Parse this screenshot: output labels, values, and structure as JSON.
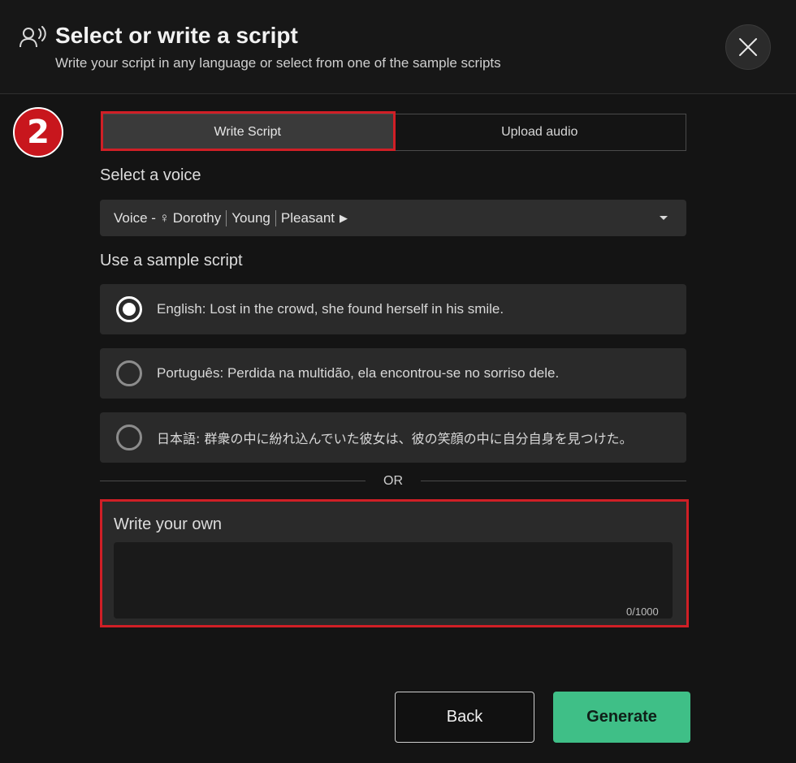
{
  "header": {
    "title": "Select or write a script",
    "subtitle": "Write your script in any language or select from one of the sample scripts",
    "icon": "voice-speaker-icon",
    "close_icon": "close-icon"
  },
  "step_badge": "2",
  "tabs": [
    {
      "label": "Write Script",
      "active": true
    },
    {
      "label": "Upload audio",
      "active": false
    }
  ],
  "voice": {
    "section_label": "Select a voice",
    "prefix": "Voice - ",
    "gender_symbol": "♀",
    "name": "Dorothy",
    "age": "Young",
    "tone": "Pleasant",
    "play_symbol": "▶"
  },
  "samples": {
    "section_label": "Use a sample script",
    "options": [
      {
        "text": "English: Lost in the crowd, she found herself in his smile.",
        "selected": true
      },
      {
        "text": "Português: Perdida na multidão, ela encontrou-se no sorriso dele.",
        "selected": false
      },
      {
        "text": "日本語: 群衆の中に紛れ込んでいた彼女は、彼の笑顔の中に自分自身を見つけた。",
        "selected": false
      }
    ]
  },
  "divider": "OR",
  "own_script": {
    "label": "Write your own",
    "value": "",
    "counter": "0/1000"
  },
  "actions": {
    "back_label": "Back",
    "generate_label": "Generate"
  },
  "colors": {
    "accent": "#3fbf87",
    "highlight": "#d01f26"
  }
}
